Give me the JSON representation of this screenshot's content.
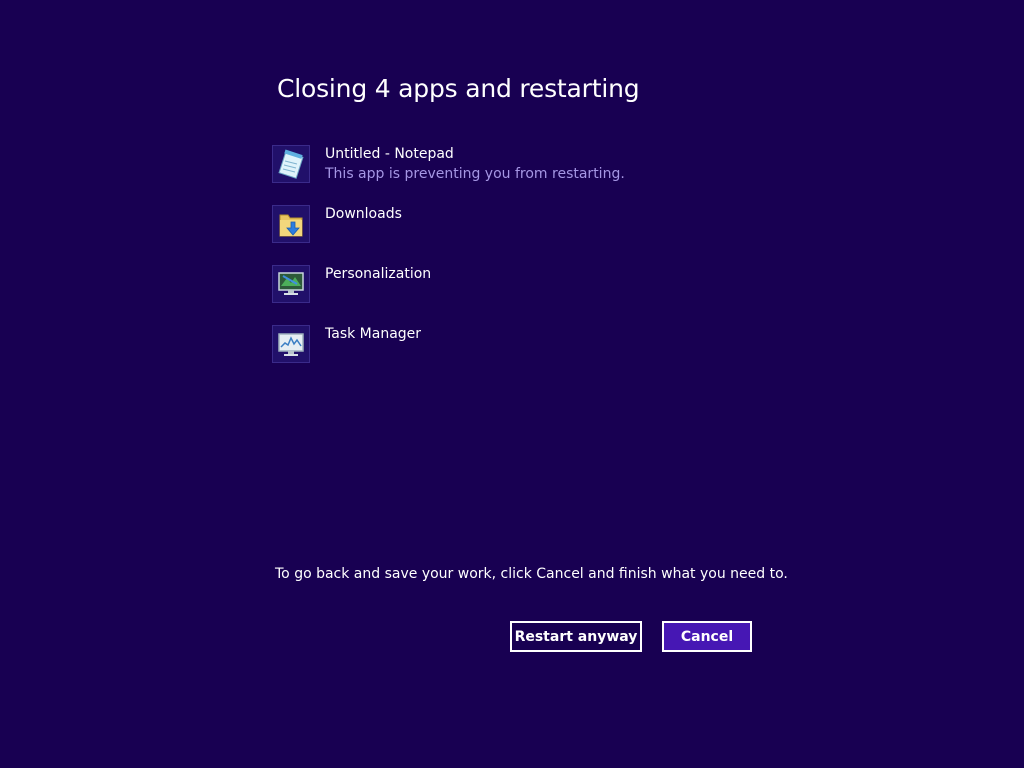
{
  "dialog": {
    "title": "Closing 4 apps and restarting",
    "apps": [
      {
        "name": "Untitled - Notepad",
        "status": "This app is preventing you from restarting.",
        "icon": "notepad-icon"
      },
      {
        "name": "Downloads",
        "status": "",
        "icon": "downloads-folder-icon"
      },
      {
        "name": "Personalization",
        "status": "",
        "icon": "personalization-icon"
      },
      {
        "name": "Task Manager",
        "status": "",
        "icon": "task-manager-icon"
      }
    ],
    "message": "To go back and save your work, click Cancel and finish what you need to.",
    "buttons": {
      "restart_label": "Restart anyway",
      "cancel_label": "Cancel"
    }
  },
  "colors": {
    "background": "#180052",
    "accent": "#4617b4",
    "subtext": "#a596e4"
  }
}
